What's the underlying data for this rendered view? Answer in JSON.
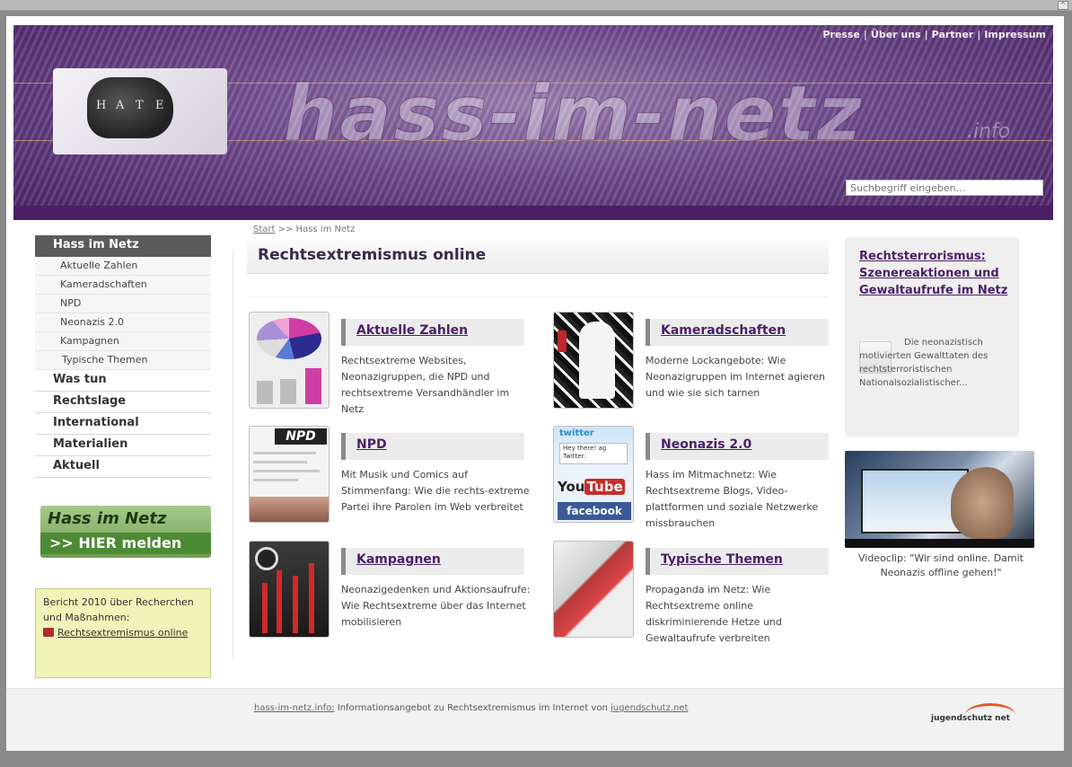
{
  "header": {
    "fist_letters": [
      "H",
      "A",
      "T",
      "E"
    ],
    "logo": "hass-im-netz",
    "logo_suffix": ".info",
    "toplinks": [
      "Presse",
      "Über uns",
      "Partner",
      "Impressum"
    ],
    "search_placeholder": "Suchbegriff eingeben..."
  },
  "nav": {
    "active": "Hass im Netz",
    "sub": [
      "Aktuelle Zahlen",
      "Kameradschaften",
      "NPD",
      "Neonazis 2.0",
      "Kampagnen",
      "Typische Themen"
    ],
    "main": [
      "Was tun",
      "Rechtslage",
      "International",
      "Materialien",
      "Aktuell"
    ]
  },
  "banner": {
    "line1": "Hass im Netz",
    "line2": ">> HIER melden"
  },
  "report": {
    "text": "Bericht 2010 über Recherchen und Maßnahmen:",
    "link": "Rechtsextremismus online"
  },
  "breadcrumb": {
    "start": "Start",
    "rest": " >> Hass im Netz"
  },
  "main": {
    "title": "Rechtsextremismus online",
    "teasers": [
      {
        "title": "Aktuelle Zahlen",
        "desc": "Rechtsextreme Websites, Neonazigruppen, die NPD und rechtsextreme Versandhändler im Netz"
      },
      {
        "title": "Kameradschaften",
        "desc": "Moderne Lockangebote: Wie Neonazigruppen im Internet agieren und wie sie sich tarnen"
      },
      {
        "title": "NPD",
        "desc": "Mit Musik und Comics auf Stimmenfang: Wie die rechts-extreme Partei ihre Parolen im Web verbreitet"
      },
      {
        "title": "Neonazis 2.0",
        "desc": "Hass im Mitmachnetz: Wie Rechtsextreme Blogs, Video-plattformen und soziale Netzwerke missbrauchen"
      },
      {
        "title": "Kampagnen",
        "desc": "Neonazigedenken und Aktionsaufrufe: Wie Rechtsextreme über das Internet mobilisieren"
      },
      {
        "title": "Typische Themen",
        "desc": "Propaganda im Netz: Wie Rechtsextreme online diskriminierende Hetze und Gewaltaufrufe verbreiten"
      }
    ],
    "npd_logo": "NPD",
    "twitter_label": "twitter",
    "tweet_text": "Hey there! ag Twitter.",
    "youtube_label": "You",
    "youtube_tube": "Tube",
    "facebook_label": "facebook"
  },
  "right": {
    "title": "Rechtsterrorismus: Szenereaktionen und Gewaltaufrufe im Netz",
    "desc": "Die neonazistisch motivierten Gewalttaten des rechtsterroristischen Nationalsozialistischer...",
    "video_caption": "Videoclip: \"Wir sind online. Damit Neonazis offline gehen!\""
  },
  "footer": {
    "site_link": "hass-im-netz.info:",
    "text": " Informationsangebot zu Rechtsextremismus im Internet von ",
    "partner_link": "jugendschutz.net",
    "logo_text": "jugendschutz",
    "logo_suffix": "net"
  },
  "colors": {
    "accent": "#4b1f68",
    "header": "#6f4a8e",
    "banner": "#6f9f52",
    "report_bg": "#f1f4b8"
  }
}
